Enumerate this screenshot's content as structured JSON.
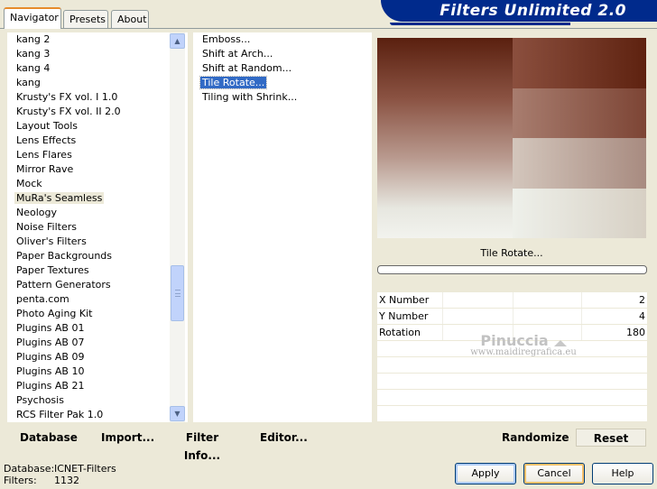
{
  "app": {
    "title": "Filters Unlimited 2.0"
  },
  "tabs": [
    {
      "label": "Navigator",
      "active": true
    },
    {
      "label": "Presets",
      "active": false
    },
    {
      "label": "About",
      "active": false
    }
  ],
  "categories": {
    "items": [
      "kang 2",
      "kang 3",
      "kang 4",
      "kang",
      "Krusty's FX vol. I 1.0",
      "Krusty's FX vol. II 2.0",
      "Layout Tools",
      "Lens Effects",
      "Lens Flares",
      "Mirror Rave",
      "Mock",
      "MuRa's Seamless",
      "Neology",
      "Noise Filters",
      "Oliver's Filters",
      "Paper Backgrounds",
      "Paper Textures",
      "Pattern Generators",
      "penta.com",
      "Photo Aging Kit",
      "Plugins AB 01",
      "Plugins AB 07",
      "Plugins AB 09",
      "Plugins AB 10",
      "Plugins AB 21",
      "Psychosis",
      "RCS Filter Pak 1.0"
    ],
    "selected_index": 11
  },
  "effects": {
    "items": [
      "Emboss...",
      "Shift at Arch...",
      "Shift at Random...",
      "Tile Rotate...",
      "Tiling with Shrink..."
    ],
    "selected_index": 3
  },
  "preview": {
    "filter_name": "Tile Rotate..."
  },
  "params": [
    {
      "label": "X Number",
      "value": "2"
    },
    {
      "label": "Y Number",
      "value": "4"
    },
    {
      "label": "Rotation",
      "value": "180"
    }
  ],
  "watermark": {
    "title": "Pinuccia",
    "subtitle": "www.maidiregrafica.eu"
  },
  "toolbar": {
    "database": "Database",
    "import": "Import...",
    "filter_info": "Filter Info...",
    "editor": "Editor...",
    "randomize": "Randomize",
    "reset": "Reset"
  },
  "status": {
    "database_label": "Database:",
    "database_value": "ICNET-Filters",
    "filters_label": "Filters:",
    "filters_value": "1132"
  },
  "buttons": {
    "apply": "Apply",
    "cancel": "Cancel",
    "help": "Help"
  }
}
